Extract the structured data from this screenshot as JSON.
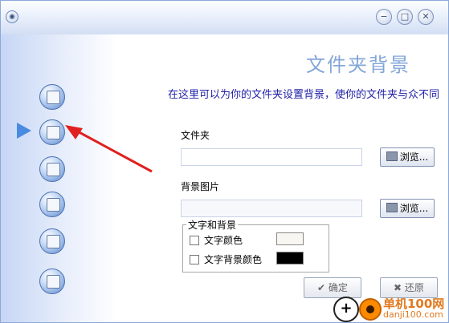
{
  "page": {
    "title": "文件夹背景",
    "description": "在这里可以为你的文件夹设置背景，使你的文件夹与众不同"
  },
  "folder": {
    "label": "文件夹",
    "value": "",
    "browse_label": "浏览..."
  },
  "background_image": {
    "label": "背景图片",
    "value": "",
    "browse_label": "浏览..."
  },
  "text_background": {
    "legend": "文字和背景",
    "text_color": {
      "label": "文字颜色",
      "checked": false,
      "color": "#f8f6f0"
    },
    "text_bg_color": {
      "label": "文字背景颜色",
      "checked": false,
      "color": "#000000"
    }
  },
  "actions": {
    "ok_label": "确定",
    "restore_label": "还原"
  },
  "nav": [
    "folder-icon",
    "folder-settings-icon",
    "folder-document-icon",
    "disk-icon",
    "monitor-icon",
    "window-icon"
  ],
  "watermark": {
    "name": "单机100网",
    "url": "danji100.com"
  },
  "colors": {
    "title": "#83a6d8",
    "description": "#1f1fa8",
    "accent_arrow": "#e02020",
    "selection_arrow": "#4a8ae0"
  }
}
